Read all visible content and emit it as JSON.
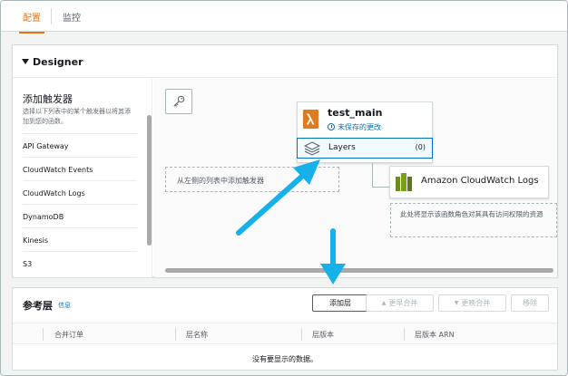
{
  "tabs": [
    {
      "label": "配置",
      "active": true
    },
    {
      "label": "监控",
      "active": false
    }
  ],
  "designer": {
    "title": "Designer",
    "sidebar": {
      "title": "添加触发器",
      "description": "选择以下列表中的某个触发器以将其添加到您的函数。",
      "triggers": [
        "API Gateway",
        "CloudWatch Events",
        "CloudWatch Logs",
        "DynamoDB",
        "Kinesis",
        "S3"
      ]
    },
    "canvas": {
      "add_trigger_placeholder": "从左侧的列表中添加触发器",
      "function": {
        "name": "test_main",
        "status": "未保存的更改",
        "layers_label": "Layers",
        "layers_count": "(0)"
      },
      "destination": {
        "label": "Amazon CloudWatch Logs",
        "permission_note": "此处将显示该函数角色对其具有访问权限的资源"
      }
    }
  },
  "reference_layers": {
    "title": "参考层",
    "info_link": "信息",
    "buttons": {
      "add": "添加层",
      "merge_earlier": "更早合并",
      "merge_later": "更晚合并",
      "remove": "移除"
    },
    "columns": [
      "合并订单",
      "层名称",
      "层版本",
      "层版本 ARN"
    ],
    "empty_message": "没有要显示的数据。"
  },
  "colors": {
    "accent": "#ec7211",
    "link": "#0073bb",
    "annotation_arrow": "#15b1e8"
  },
  "icons": {
    "trigger_key": "key-icon",
    "lambda": "lambda-function-icon",
    "layers": "layers-icon",
    "cloudwatch": "cloudwatch-logs-icon"
  }
}
